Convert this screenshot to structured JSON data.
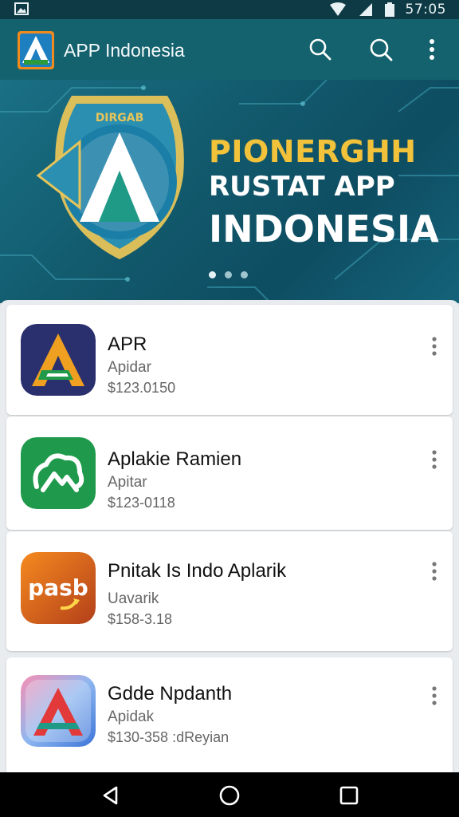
{
  "status_bar": {
    "time": "57:05",
    "icons": [
      "gallery-icon",
      "wifi-icon",
      "signal-icon",
      "battery-icon"
    ]
  },
  "app_bar": {
    "title": "APP Indonesia",
    "actions": [
      "search-icon",
      "search-icon",
      "more-vert-icon"
    ]
  },
  "banner": {
    "line1": "PIONERGHH",
    "line2": "RUSTAT APP",
    "line3": "INDONESIA",
    "emblem_text": "DIRGAB",
    "slide_count": 3,
    "active_slide": 1,
    "colors": {
      "gold": "#f1c23a",
      "teal": "#125a6d"
    }
  },
  "apps": [
    {
      "name": "APR",
      "developer": "Apidar",
      "price": "$123.0150",
      "icon": "app-a-logo-icon"
    },
    {
      "name": "Aplakie Ramien",
      "developer": "Apitar",
      "price": "$123-0118",
      "icon": "cloud-mountain-logo-icon"
    },
    {
      "name": "Pnitak Is Indo Aplarik",
      "developer": "Uavarik",
      "price": "$158-3.18",
      "icon": "pasb-logo-icon",
      "icon_text": "pasb"
    },
    {
      "name": "Gdde Npdanth",
      "developer": "Apidak",
      "price": "$130-358 :dReyian",
      "icon": "rainbow-a-logo-icon"
    }
  ],
  "nav": [
    "back-icon",
    "home-icon",
    "recents-icon"
  ]
}
